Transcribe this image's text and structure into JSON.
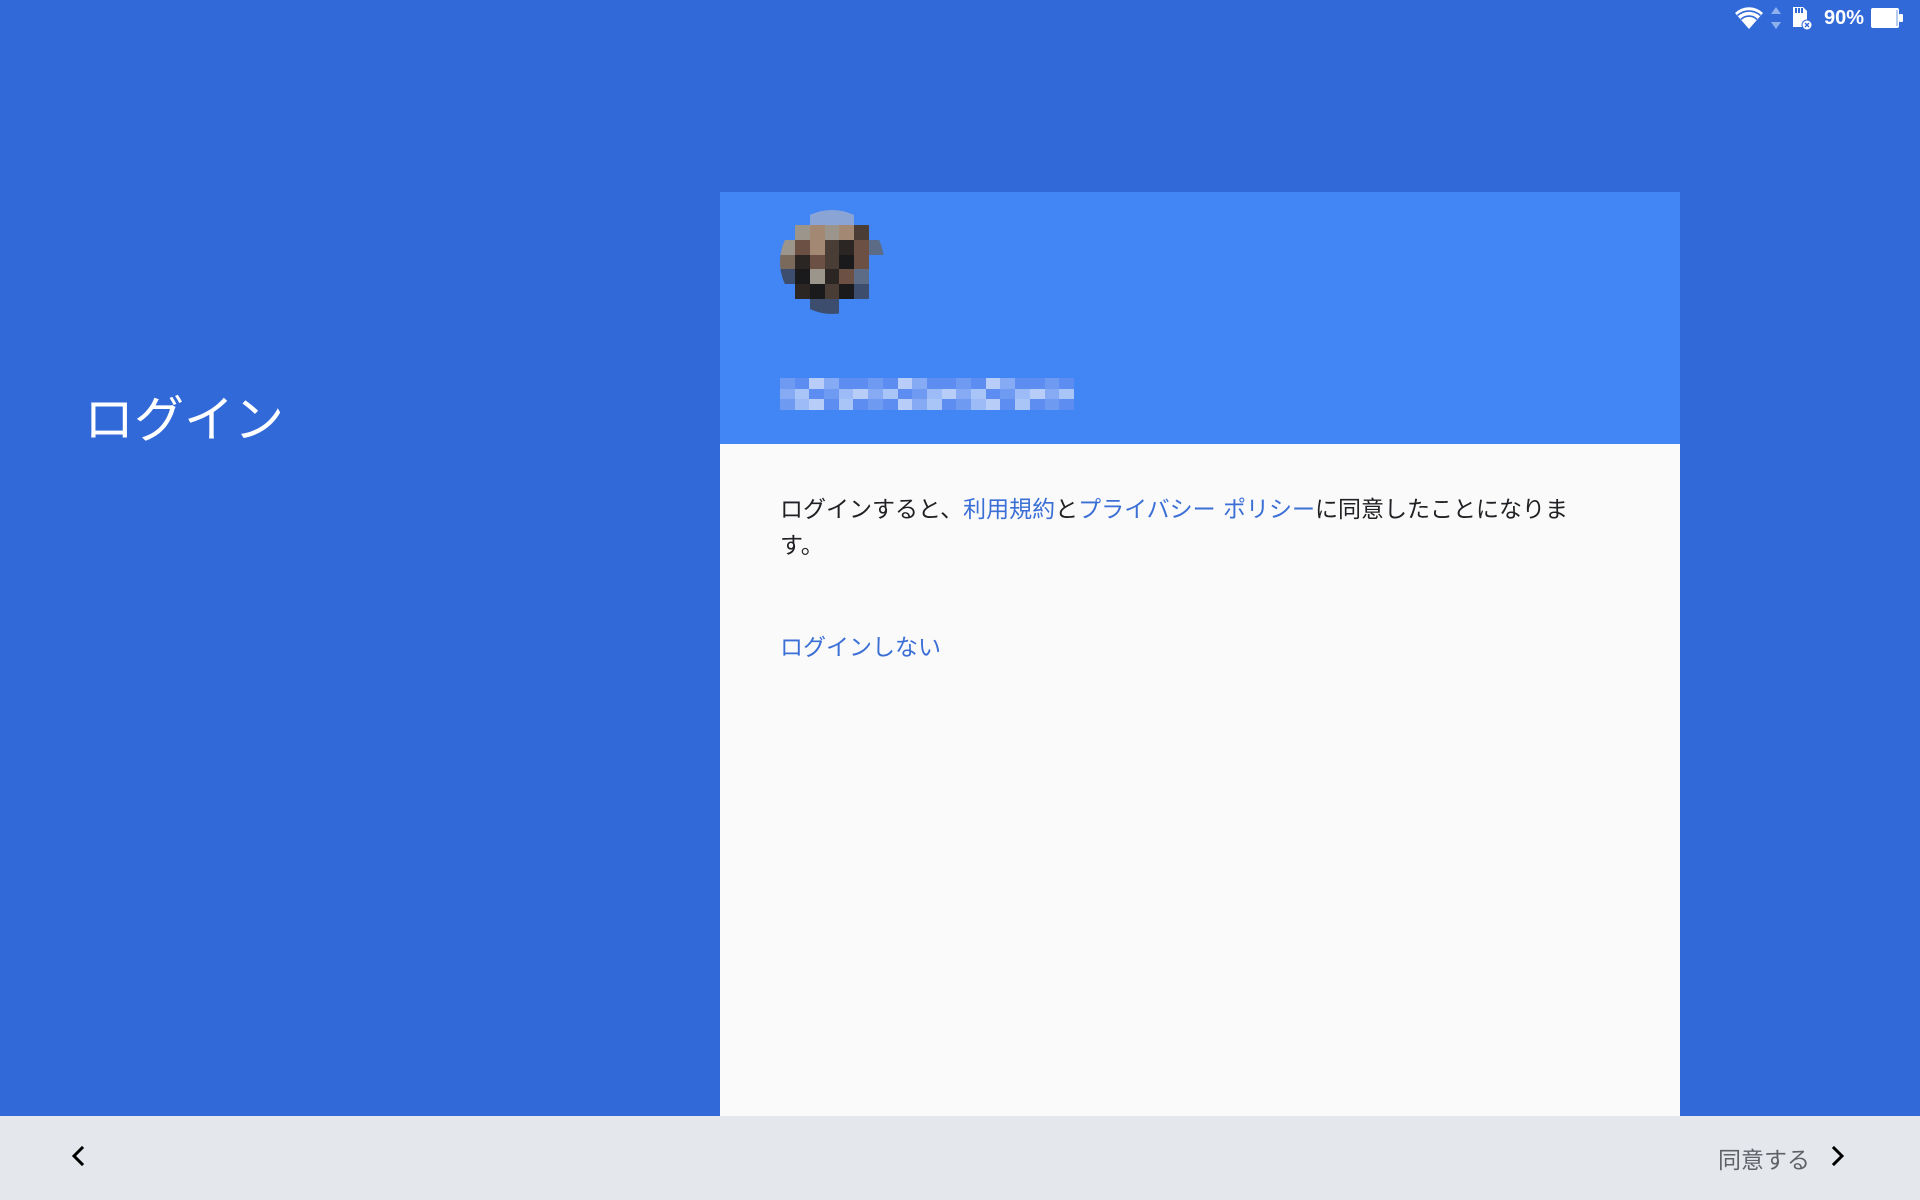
{
  "status_bar": {
    "battery_percent": "90%",
    "icons": [
      "wifi-icon",
      "data-arrows-icon",
      "sd-card-icon",
      "battery-icon"
    ]
  },
  "page": {
    "title": "ログイン"
  },
  "card": {
    "terms": {
      "prefix": "ログインすると、",
      "terms_link": "利用規約",
      "conjunction": "と",
      "privacy_link": "プライバシー ポリシー",
      "suffix": "に同意したことになります。"
    },
    "skip_link": "ログインしない"
  },
  "bottom_bar": {
    "agree_label": "同意する",
    "back_icon": "chevron-left-icon",
    "next_icon": "chevron-right-icon"
  },
  "colors": {
    "background": "#3269d8",
    "card_header": "#4285f4",
    "card_body": "#fafafa",
    "link": "#3b6fd6",
    "bottom_bar": "#e4e8ec"
  }
}
